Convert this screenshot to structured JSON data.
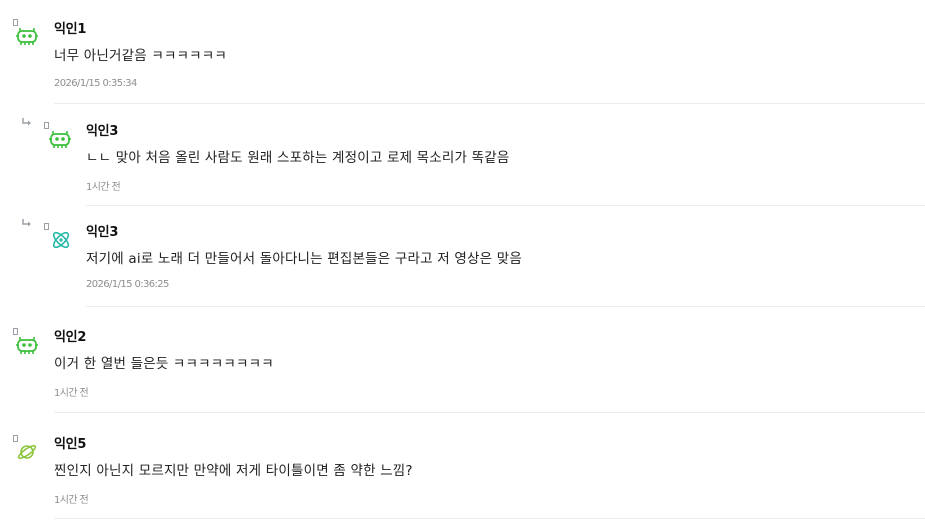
{
  "comments": [
    {
      "author": "익인1",
      "text": "너무 아닌거같음 ㅋㅋㅋㅋㅋㅋ",
      "time": "2026/1/15 0:35:34",
      "reply": false,
      "avatar_icon": "monster-icon",
      "avatar_color": "#3cbf3c"
    },
    {
      "author": "익인3",
      "text": "ㄴㄴ 맞아 처음 올린 사람도 원래 스포하는 계정이고 로제 목소리가 똑같음",
      "time": "1시간 전",
      "reply": true,
      "avatar_icon": "monster-icon",
      "avatar_color": "#3cbf3c"
    },
    {
      "author": "익인3",
      "text": "저기에 ai로 노래 더 만들어서 돌아다니는 편집본들은 구라고 저 영상은 맞음",
      "time": "2026/1/15 0:36:25",
      "reply": true,
      "avatar_icon": "atom-icon",
      "avatar_color": "#26b8a8"
    },
    {
      "author": "익인2",
      "text": "이거 한 열번 들은듯 ㅋㅋㅋㅋㅋㅋㅋㅋ",
      "time": "1시간 전",
      "reply": false,
      "avatar_icon": "monster-icon",
      "avatar_color": "#3cbf3c"
    },
    {
      "author": "익인5",
      "text": "찐인지 아닌지 모르지만 만약에 저게 타이틀이면 좀 약한 느낌?",
      "time": "1시간 전",
      "reply": false,
      "avatar_icon": "planet-icon",
      "avatar_color": "#8cc63f"
    }
  ]
}
